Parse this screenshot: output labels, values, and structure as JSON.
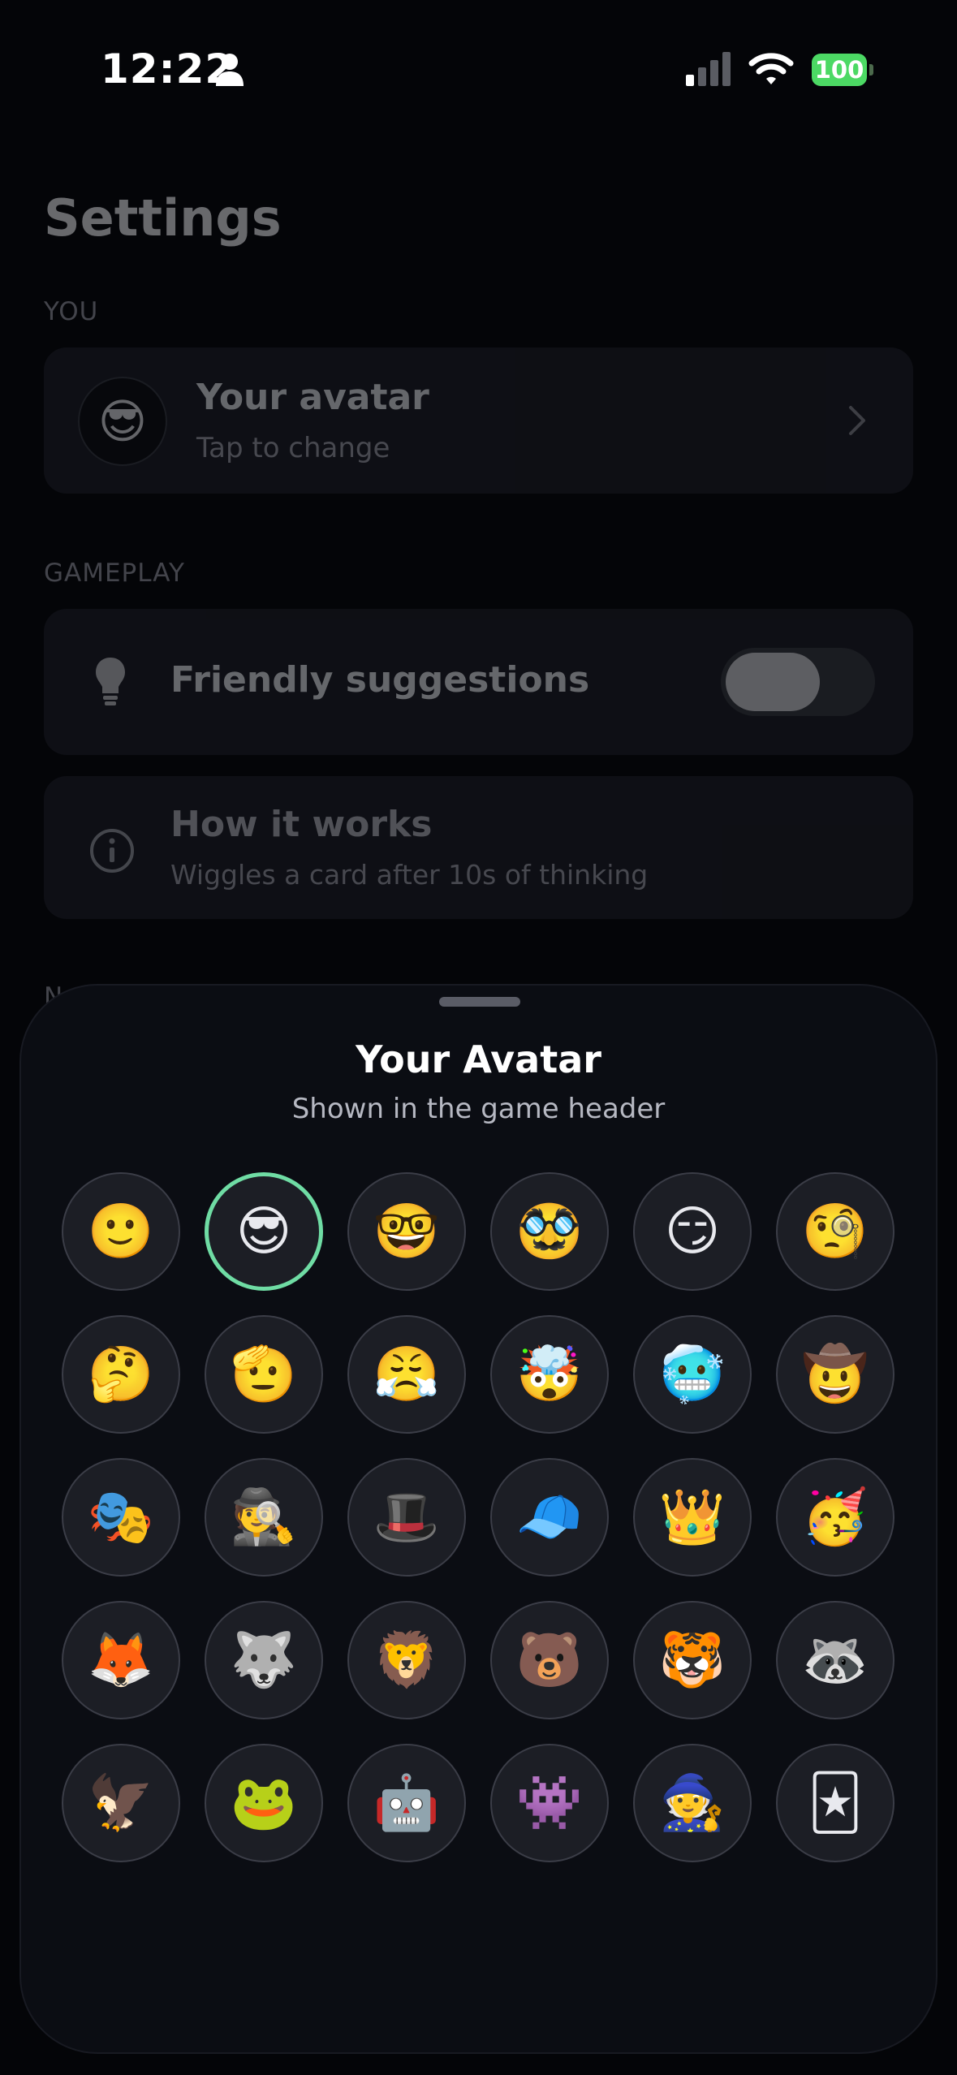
{
  "status_bar": {
    "time": "12:22",
    "battery": "100"
  },
  "settings": {
    "title": "Settings",
    "sections": {
      "you": "YOU",
      "gameplay": "GAMEPLAY"
    },
    "avatar_row": {
      "emoji": "😎",
      "title": "Your avatar",
      "subtitle": "Tap to change"
    },
    "suggestions_row": {
      "title": "Friendly suggestions",
      "enabled": false
    },
    "how_row": {
      "title": "How it works",
      "subtitle": "Wiggles a card after 10s of thinking"
    },
    "next_section_peek": "N"
  },
  "sheet": {
    "title": "Your Avatar",
    "subtitle": "Shown in the game header",
    "selected_index": 1,
    "avatars": [
      "🙂",
      "😎",
      "🤓",
      "🥸",
      "😏",
      "🧐",
      "🤔",
      "🫡",
      "😤",
      "🤯",
      "🥶",
      "🤠",
      "🎭",
      "🕵️",
      "🎩",
      "🧢",
      "👑",
      "🥳",
      "🦊",
      "🐺",
      "🦁",
      "🐻",
      "🐯",
      "🦝",
      "🦅",
      "🐸",
      "🤖",
      "👾",
      "🧙",
      "🃏"
    ]
  },
  "colors": {
    "accent_selected": "#6fdca4",
    "battery": "#4cd964"
  }
}
